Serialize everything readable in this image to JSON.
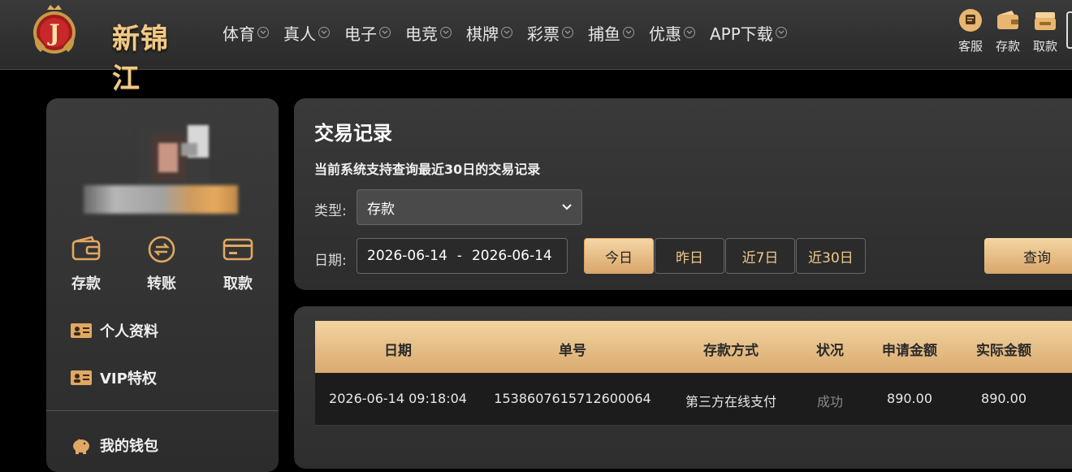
{
  "brand": {
    "name": "新锦江",
    "logo_letter": "J"
  },
  "nav": [
    {
      "label": "体育"
    },
    {
      "label": "真人"
    },
    {
      "label": "电子"
    },
    {
      "label": "电竞"
    },
    {
      "label": "棋牌"
    },
    {
      "label": "彩票"
    },
    {
      "label": "捕鱼"
    },
    {
      "label": "优惠"
    },
    {
      "label": "APP下载"
    }
  ],
  "tools": [
    {
      "label": "客服",
      "icon": "chat-icon"
    },
    {
      "label": "存款",
      "icon": "wallet-icon"
    },
    {
      "label": "取款",
      "icon": "cash-icon"
    }
  ],
  "sidebar": {
    "quick_actions": [
      {
        "label": "存款",
        "icon": "wallet-icon"
      },
      {
        "label": "转账",
        "icon": "transfer-icon"
      },
      {
        "label": "取款",
        "icon": "card-icon"
      }
    ],
    "menu": [
      {
        "label": "个人资料",
        "icon": "id-card-icon"
      },
      {
        "label": "VIP特权",
        "icon": "id-card-icon"
      },
      {
        "label": "我的钱包",
        "icon": "piggy-bank-icon"
      }
    ]
  },
  "main": {
    "title": "交易记录",
    "subtitle": "当前系统支持查询最近30日的交易记录",
    "type_label": "类型:",
    "type_value": "存款",
    "date_label": "日期:",
    "date_start": "2026-06-14",
    "date_sep": "-",
    "date_end": "2026-06-14",
    "ranges": [
      "今日",
      "昨日",
      "近7日",
      "近30日"
    ],
    "active_range": "今日",
    "query_label": "查询"
  },
  "table": {
    "columns": [
      "日期",
      "单号",
      "存款方式",
      "状况",
      "申请金额",
      "实际金额"
    ],
    "rows": [
      [
        "2026-06-14 09:18:04",
        "1538607615712600064",
        "第三方在线支付",
        "成功",
        "890.00",
        "890.00"
      ]
    ]
  },
  "colors": {
    "accent": "#e0b070",
    "background": "#000000",
    "panel": "#333333"
  }
}
